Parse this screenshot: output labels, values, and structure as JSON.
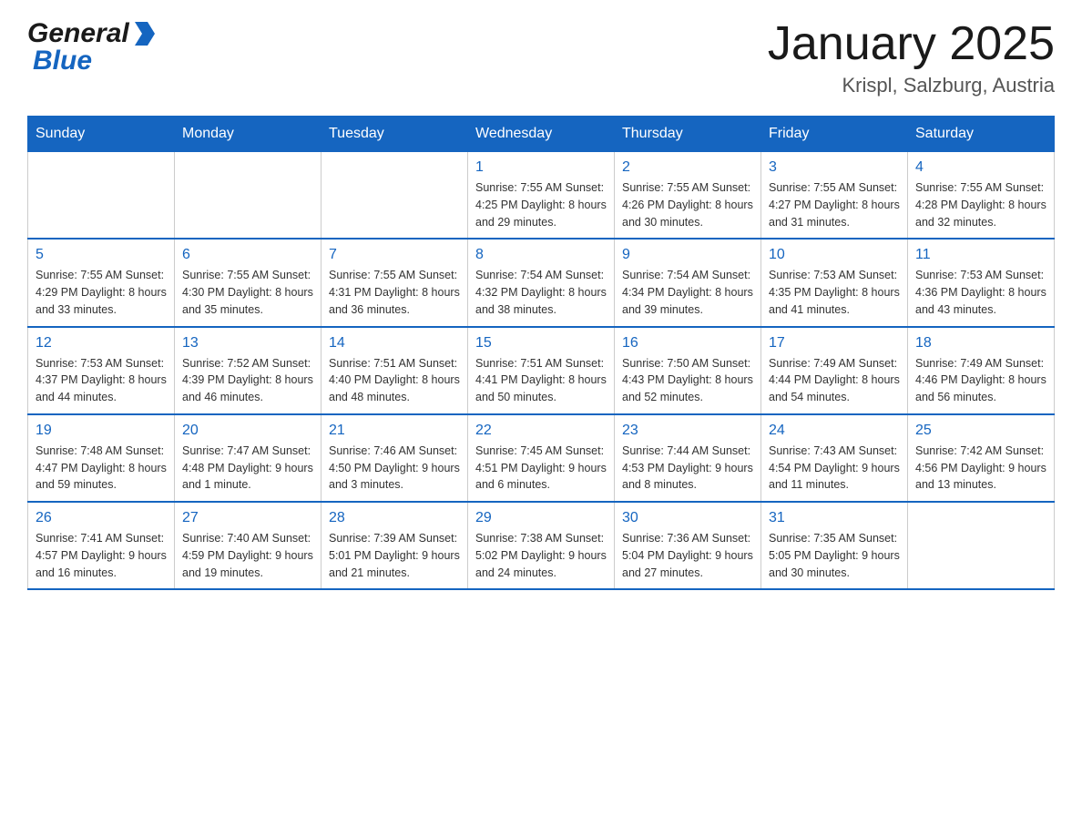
{
  "logo": {
    "general": "General",
    "blue": "Blue",
    "tagline": ""
  },
  "header": {
    "title": "January 2025",
    "subtitle": "Krispl, Salzburg, Austria"
  },
  "days": [
    "Sunday",
    "Monday",
    "Tuesday",
    "Wednesday",
    "Thursday",
    "Friday",
    "Saturday"
  ],
  "weeks": [
    [
      {
        "day": "",
        "info": ""
      },
      {
        "day": "",
        "info": ""
      },
      {
        "day": "",
        "info": ""
      },
      {
        "day": "1",
        "info": "Sunrise: 7:55 AM\nSunset: 4:25 PM\nDaylight: 8 hours\nand 29 minutes."
      },
      {
        "day": "2",
        "info": "Sunrise: 7:55 AM\nSunset: 4:26 PM\nDaylight: 8 hours\nand 30 minutes."
      },
      {
        "day": "3",
        "info": "Sunrise: 7:55 AM\nSunset: 4:27 PM\nDaylight: 8 hours\nand 31 minutes."
      },
      {
        "day": "4",
        "info": "Sunrise: 7:55 AM\nSunset: 4:28 PM\nDaylight: 8 hours\nand 32 minutes."
      }
    ],
    [
      {
        "day": "5",
        "info": "Sunrise: 7:55 AM\nSunset: 4:29 PM\nDaylight: 8 hours\nand 33 minutes."
      },
      {
        "day": "6",
        "info": "Sunrise: 7:55 AM\nSunset: 4:30 PM\nDaylight: 8 hours\nand 35 minutes."
      },
      {
        "day": "7",
        "info": "Sunrise: 7:55 AM\nSunset: 4:31 PM\nDaylight: 8 hours\nand 36 minutes."
      },
      {
        "day": "8",
        "info": "Sunrise: 7:54 AM\nSunset: 4:32 PM\nDaylight: 8 hours\nand 38 minutes."
      },
      {
        "day": "9",
        "info": "Sunrise: 7:54 AM\nSunset: 4:34 PM\nDaylight: 8 hours\nand 39 minutes."
      },
      {
        "day": "10",
        "info": "Sunrise: 7:53 AM\nSunset: 4:35 PM\nDaylight: 8 hours\nand 41 minutes."
      },
      {
        "day": "11",
        "info": "Sunrise: 7:53 AM\nSunset: 4:36 PM\nDaylight: 8 hours\nand 43 minutes."
      }
    ],
    [
      {
        "day": "12",
        "info": "Sunrise: 7:53 AM\nSunset: 4:37 PM\nDaylight: 8 hours\nand 44 minutes."
      },
      {
        "day": "13",
        "info": "Sunrise: 7:52 AM\nSunset: 4:39 PM\nDaylight: 8 hours\nand 46 minutes."
      },
      {
        "day": "14",
        "info": "Sunrise: 7:51 AM\nSunset: 4:40 PM\nDaylight: 8 hours\nand 48 minutes."
      },
      {
        "day": "15",
        "info": "Sunrise: 7:51 AM\nSunset: 4:41 PM\nDaylight: 8 hours\nand 50 minutes."
      },
      {
        "day": "16",
        "info": "Sunrise: 7:50 AM\nSunset: 4:43 PM\nDaylight: 8 hours\nand 52 minutes."
      },
      {
        "day": "17",
        "info": "Sunrise: 7:49 AM\nSunset: 4:44 PM\nDaylight: 8 hours\nand 54 minutes."
      },
      {
        "day": "18",
        "info": "Sunrise: 7:49 AM\nSunset: 4:46 PM\nDaylight: 8 hours\nand 56 minutes."
      }
    ],
    [
      {
        "day": "19",
        "info": "Sunrise: 7:48 AM\nSunset: 4:47 PM\nDaylight: 8 hours\nand 59 minutes."
      },
      {
        "day": "20",
        "info": "Sunrise: 7:47 AM\nSunset: 4:48 PM\nDaylight: 9 hours\nand 1 minute."
      },
      {
        "day": "21",
        "info": "Sunrise: 7:46 AM\nSunset: 4:50 PM\nDaylight: 9 hours\nand 3 minutes."
      },
      {
        "day": "22",
        "info": "Sunrise: 7:45 AM\nSunset: 4:51 PM\nDaylight: 9 hours\nand 6 minutes."
      },
      {
        "day": "23",
        "info": "Sunrise: 7:44 AM\nSunset: 4:53 PM\nDaylight: 9 hours\nand 8 minutes."
      },
      {
        "day": "24",
        "info": "Sunrise: 7:43 AM\nSunset: 4:54 PM\nDaylight: 9 hours\nand 11 minutes."
      },
      {
        "day": "25",
        "info": "Sunrise: 7:42 AM\nSunset: 4:56 PM\nDaylight: 9 hours\nand 13 minutes."
      }
    ],
    [
      {
        "day": "26",
        "info": "Sunrise: 7:41 AM\nSunset: 4:57 PM\nDaylight: 9 hours\nand 16 minutes."
      },
      {
        "day": "27",
        "info": "Sunrise: 7:40 AM\nSunset: 4:59 PM\nDaylight: 9 hours\nand 19 minutes."
      },
      {
        "day": "28",
        "info": "Sunrise: 7:39 AM\nSunset: 5:01 PM\nDaylight: 9 hours\nand 21 minutes."
      },
      {
        "day": "29",
        "info": "Sunrise: 7:38 AM\nSunset: 5:02 PM\nDaylight: 9 hours\nand 24 minutes."
      },
      {
        "day": "30",
        "info": "Sunrise: 7:36 AM\nSunset: 5:04 PM\nDaylight: 9 hours\nand 27 minutes."
      },
      {
        "day": "31",
        "info": "Sunrise: 7:35 AM\nSunset: 5:05 PM\nDaylight: 9 hours\nand 30 minutes."
      },
      {
        "day": "",
        "info": ""
      }
    ]
  ]
}
